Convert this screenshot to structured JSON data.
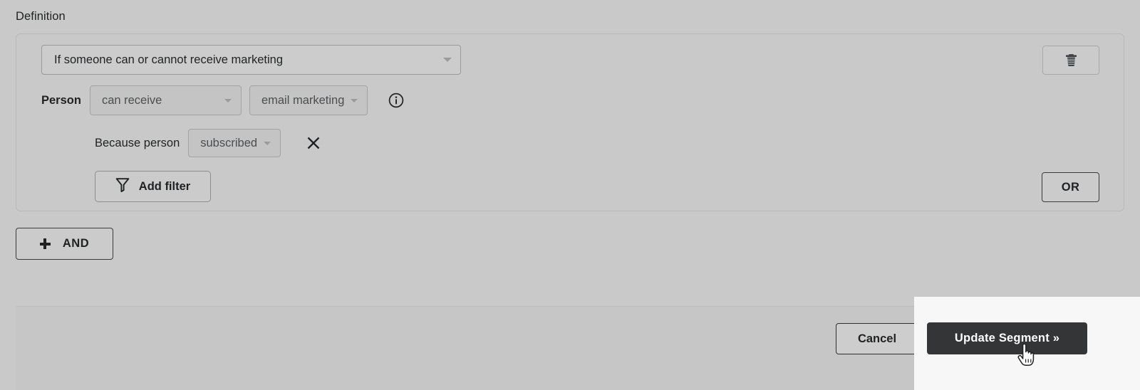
{
  "section": {
    "label": "Definition"
  },
  "definition": {
    "type_selector": {
      "value": "If someone can or cannot receive marketing",
      "caret_icon": "chevron-down-icon"
    },
    "delete_button": {
      "icon": "trash-icon"
    },
    "person_row": {
      "subject": "Person",
      "condition": "can receive",
      "channel": "email marketing",
      "info_icon": "info-circle-icon"
    },
    "reason_row": {
      "prefix": "Because person",
      "value": "subscribed",
      "remove_icon": "close-x-icon"
    },
    "add_filter": {
      "label": "Add filter",
      "icon": "funnel-icon"
    },
    "or_button": {
      "label": "OR"
    }
  },
  "and_button": {
    "label": "AND",
    "icon": "plus-icon"
  },
  "footer": {
    "cancel_label": "Cancel",
    "submit_label": "Update Segment »"
  },
  "cursor": {
    "icon": "pointing-hand-cursor"
  },
  "colors": {
    "page_background": "#c9c9c9",
    "footer_background": "#c6c6c6",
    "overlay_background": "#f7f7f7",
    "primary_button": "#333536",
    "primary_button_text": "#ffffff",
    "text": "#1f2123",
    "muted_text": "#4b4e50",
    "border": "#b9b9b9"
  }
}
